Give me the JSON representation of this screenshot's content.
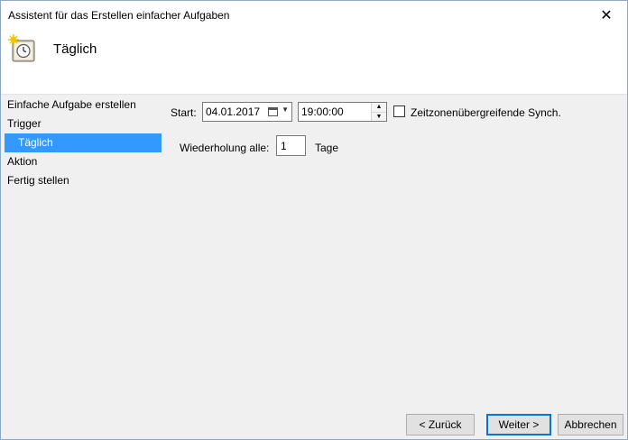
{
  "window": {
    "title": "Assistent für das Erstellen einfacher Aufgaben",
    "close_glyph": "✕"
  },
  "header": {
    "title": "Täglich",
    "icon": "task-scheduler-clock-icon"
  },
  "nav": {
    "items": [
      {
        "label": "Einfache Aufgabe erstellen"
      },
      {
        "label": "Trigger"
      },
      {
        "label": "Täglich",
        "selected": true
      },
      {
        "label": "Aktion"
      },
      {
        "label": "Fertig stellen"
      }
    ]
  },
  "trigger": {
    "start_label": "Start:",
    "start_date": "04.01.2017",
    "start_time": "19:00:00",
    "sync_label": "Zeitzonenübergreifende Synch.",
    "sync_checked": false,
    "repeat_label": "Wiederholung alle:",
    "repeat_value": "1",
    "repeat_unit": "Tage"
  },
  "buttons": {
    "back": "< Zurück",
    "next": "Weiter >",
    "cancel": "Abbrechen"
  },
  "colors": {
    "selection": "#3399ff",
    "default_button_border": "#0078d7"
  }
}
